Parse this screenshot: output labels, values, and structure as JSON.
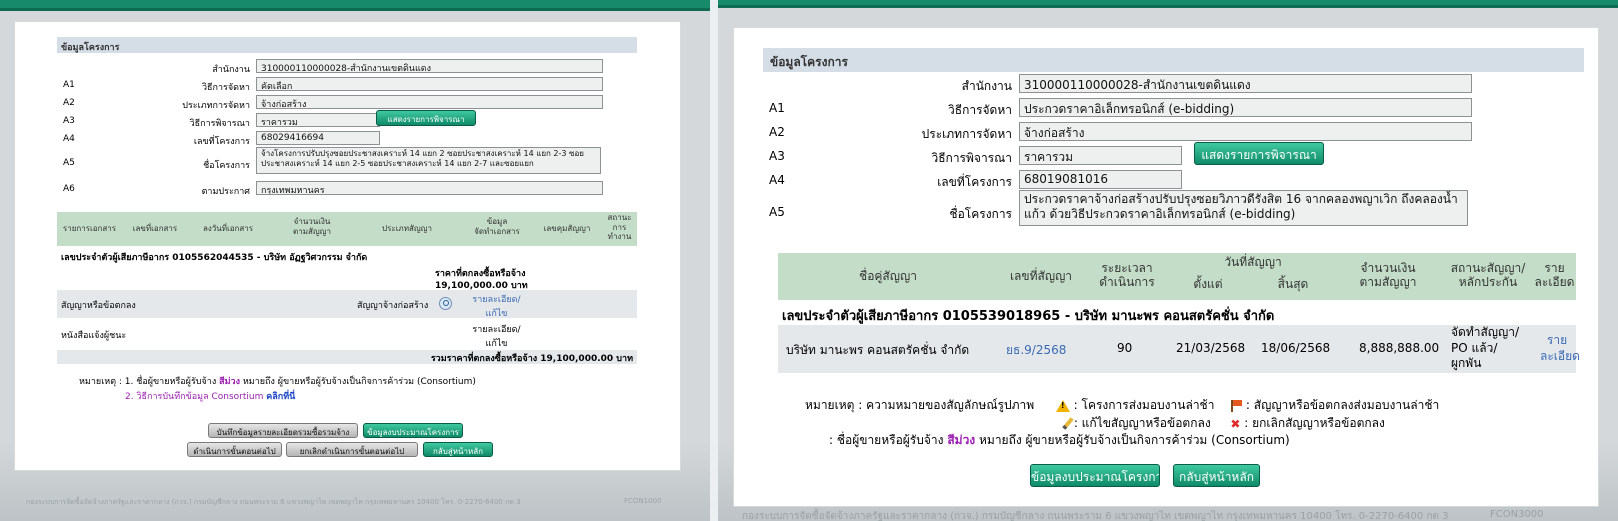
{
  "left": {
    "section_title": "ข้อมูลโครงการ",
    "rows": [
      {
        "code": "",
        "label": "สำนักงาน",
        "value": "310000110000028-สำนักงานเขตดินแดง"
      },
      {
        "code": "A1",
        "label": "วิธีการจัดหา",
        "value": "คัดเลือก"
      },
      {
        "code": "A2",
        "label": "ประเภทการจัดหา",
        "value": "จ้างก่อสร้าง"
      },
      {
        "code": "A3",
        "label": "วิธีการพิจารณา",
        "value": "ราคารวม"
      },
      {
        "code": "A4",
        "label": "เลขที่โครงการ",
        "value": "68029416694"
      },
      {
        "code": "A5",
        "label": "ชื่อโครงการ",
        "value": "จ้างโครงการปรับปรุงซอยประชาสงเคราะห์ 14 แยก 2 ซอยประชาสงเคราะห์ 14 แยก 2-3 ซอยประชาสงเคราะห์ 14 แยก 2-5 ซอยประชาสงเคราะห์ 14 แยก 2-7 และซอยแยก"
      },
      {
        "code": "A6",
        "label": "ตามประกาศ",
        "value": "กรุงเทพมหานคร"
      }
    ],
    "show_consider_button": "แสดงรายการพิจารณา",
    "table_headers": [
      "รายการเอกสาร",
      "เลขที่เอกสาร",
      "ลงวันที่เอกสาร",
      "จำนวนเงิน\nตามสัญญา",
      "ประเภทสัญญา",
      "ข้อมูล\nจัดทำเอกสาร",
      "เลขคุมสัญญา",
      "สถานะ\nการ\nทำงาน"
    ],
    "company": "เลขประจำตัวผู้เสียภาษีอากร 0105562044535 - บริษัท อัฏฐวิศวกรรม จำกัด",
    "agreed_price_label": "ราคาที่ตกลงซื้อหรือจ้าง",
    "agreed_price_value": "19,100,000.00 บาท",
    "doc1_name": "สัญญาหรือข้อตกลง",
    "doc1_type": "สัญญาจ้างก่อสร้าง",
    "doc1_link": "รายละเอียด/\nแก้ไข",
    "doc2_name": "หนังสือแจ้งผู้ชนะ",
    "doc2_link": "รายละเอียด/\nแก้ไข",
    "total_label": "รวมราคาที่ตกลงซื้อหรือจ้าง 19,100,000.00 บาท",
    "note_prefix": "หมายเหตุ : 1. ชื่อผู้ขายหรือผู้รับจ้าง",
    "note_purple": "สีม่วง",
    "note_rest": "หมายถึง ผู้ขายหรือผู้รับจ้างเป็นกิจการค้าร่วม (Consortium)",
    "note2_prefix": "2. วิธีการบันทึกข้อมูล Consortium",
    "note2_link": "คลิกที่นี่",
    "buttons": {
      "save_summary": "บันทึกข้อมูลรายละเอียดรวมซื้อรวมจ้าง",
      "budget_info": "ข้อมูลงบประมาณโครงการ",
      "next_step": "ดำเนินการขั้นตอนต่อไป",
      "cancel_next": "ยกเลิกดำเนินการขั้นตอนต่อไป",
      "back_main": "กลับสู่หน้าหลัก"
    },
    "footer": "กองระบบการจัดซื้อจัดจ้างภาครัฐและราคากลาง (กวจ.) กรมบัญชีกลาง ถนนพระราม 6 แขวงพญาไท เขตพญาไท กรุงเทพมหานคร 10400 โทร. 0-2270-6400 กด 3",
    "code": "FCON1000"
  },
  "right": {
    "section_title": "ข้อมูลโครงการ",
    "rows": [
      {
        "code": "",
        "label": "สำนักงาน",
        "value": "310000110000028-สำนักงานเขตดินแดง"
      },
      {
        "code": "A1",
        "label": "วิธีการจัดหา",
        "value": "ประกวดราคาอิเล็กทรอนิกส์ (e-bidding)"
      },
      {
        "code": "A2",
        "label": "ประเภทการจัดหา",
        "value": "จ้างก่อสร้าง"
      },
      {
        "code": "A3",
        "label": "วิธีการพิจารณา",
        "value": "ราคารวม"
      },
      {
        "code": "A4",
        "label": "เลขที่โครงการ",
        "value": "68019081016"
      },
      {
        "code": "A5",
        "label": "ชื่อโครงการ",
        "value": "ประกวดราคาจ้างก่อสร้างปรับปรุงซอยวิภาวดีรังสิต 16 จากคลองพญาเวิก ถึงคลองน้ำแก้ว ด้วยวิธีประกวดราคาอิเล็กทรอนิกส์ (e-bidding)"
      }
    ],
    "show_consider_button": "แสดงรายการพิจารณา",
    "table_headers": {
      "partner": "ชื่อคู่สัญญา",
      "contract_no": "เลขที่สัญญา",
      "duration": "ระยะเวลา\nดำเนินการ",
      "contract_date": "วันที่สัญญา",
      "start": "ตั้งแต่",
      "end": "สิ้นสุด",
      "amount": "จำนวนเงิน\nตามสัญญา",
      "status": "สถานะสัญญา/\nหลักประกัน",
      "detail": "ราย\nละเอียด"
    },
    "company": "เลขประจำตัวผู้เสียภาษีอากร 0105539018965 - บริษัท มานะพร คอนสตรัคชั่น จำกัด",
    "row": {
      "partner": "บริษัท มานะพร คอนสตรัคชั่น จำกัด",
      "contract_no": "ยธ.9/2568",
      "duration": "90",
      "start": "21/03/2568",
      "end": "18/06/2568",
      "amount": "8,888,888.00",
      "status": "จัดทำสัญญา/\nPO แล้ว/\nผูกพัน",
      "detail": "ราย\nละเอียด"
    },
    "legend": {
      "prefix": "หมายเหตุ : ความหมายของสัญลักษณ์รูปภาพ",
      "late_delivery": ": โครงการส่งมอบงานล่าช้า",
      "contract_late": ": สัญญาหรือข้อตกลงส่งมอบงานล่าช้า",
      "edit": ": แก้ไขสัญญาหรือข้อตกลง",
      "cancel": ": ยกเลิกสัญญาหรือข้อตกลง",
      "consortium_prefix": ": ชื่อผู้ขายหรือผู้รับจ้าง",
      "consortium_purple": "สีม่วง",
      "consortium_rest": "หมายถึง ผู้ขายหรือผู้รับจ้างเป็นกิจการค้าร่วม (Consortium)"
    },
    "buttons": {
      "budget_info": "ข้อมูลงบประมาณโครงการ",
      "back_main": "กลับสู่หน้าหลัก"
    },
    "footer": "กองระบบการจัดซื้อจัดจ้างภาครัฐและราคากลาง (กวจ.) กรมบัญชีกลาง ถนนพระราม 6 แขวงพญาไท เขตพญาไท กรุงเทพมหานคร 10400 โทร. 0-2270-6400 กด 3",
    "code": "FCON3000"
  }
}
